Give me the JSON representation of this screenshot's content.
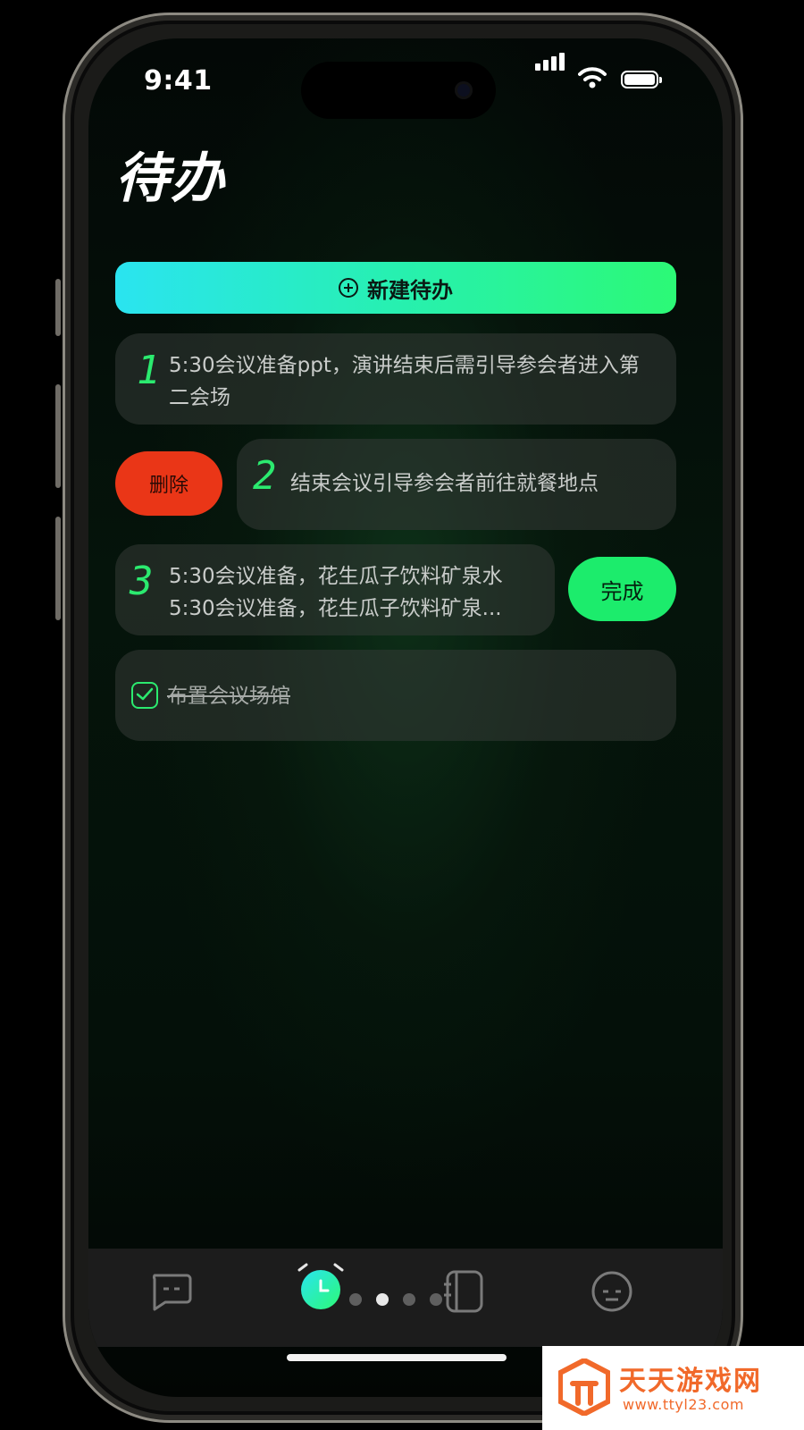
{
  "status_bar": {
    "time": "9:41"
  },
  "header": {
    "title": "待办"
  },
  "new_todo_button": {
    "label": "新建待办"
  },
  "todos": [
    {
      "index": "1",
      "text": "5:30会议准备ppt，演讲结束后需引导参会者进入第二会场"
    },
    {
      "index": "2",
      "text": "结束会议引导参会者前往就餐地点",
      "swipe_action": "删除"
    },
    {
      "index": "3",
      "lines": [
        "5:30会议准备，花生瓜子饮料矿泉水",
        "5:30会议准备，花生瓜子饮料矿泉..."
      ],
      "swipe_action": "完成"
    },
    {
      "text": "布置会议场馆",
      "completed": true
    }
  ],
  "tab_bar": {
    "tabs": [
      {
        "icon": "chat-bubble-icon"
      },
      {
        "icon": "alarm-clock-icon",
        "active": true
      },
      {
        "icon": "notebook-icon"
      },
      {
        "icon": "face-icon"
      }
    ],
    "page_indicator": {
      "count": 4,
      "active_index": 1
    }
  },
  "colors": {
    "accent": "#2bea6f",
    "delete": "#ea3617",
    "done": "#1cec6c",
    "gradient_start": "#2ae4f0",
    "gradient_end": "#2cf976"
  },
  "watermark": {
    "title": "天天游戏网",
    "url": "www.ttyl23.com"
  }
}
